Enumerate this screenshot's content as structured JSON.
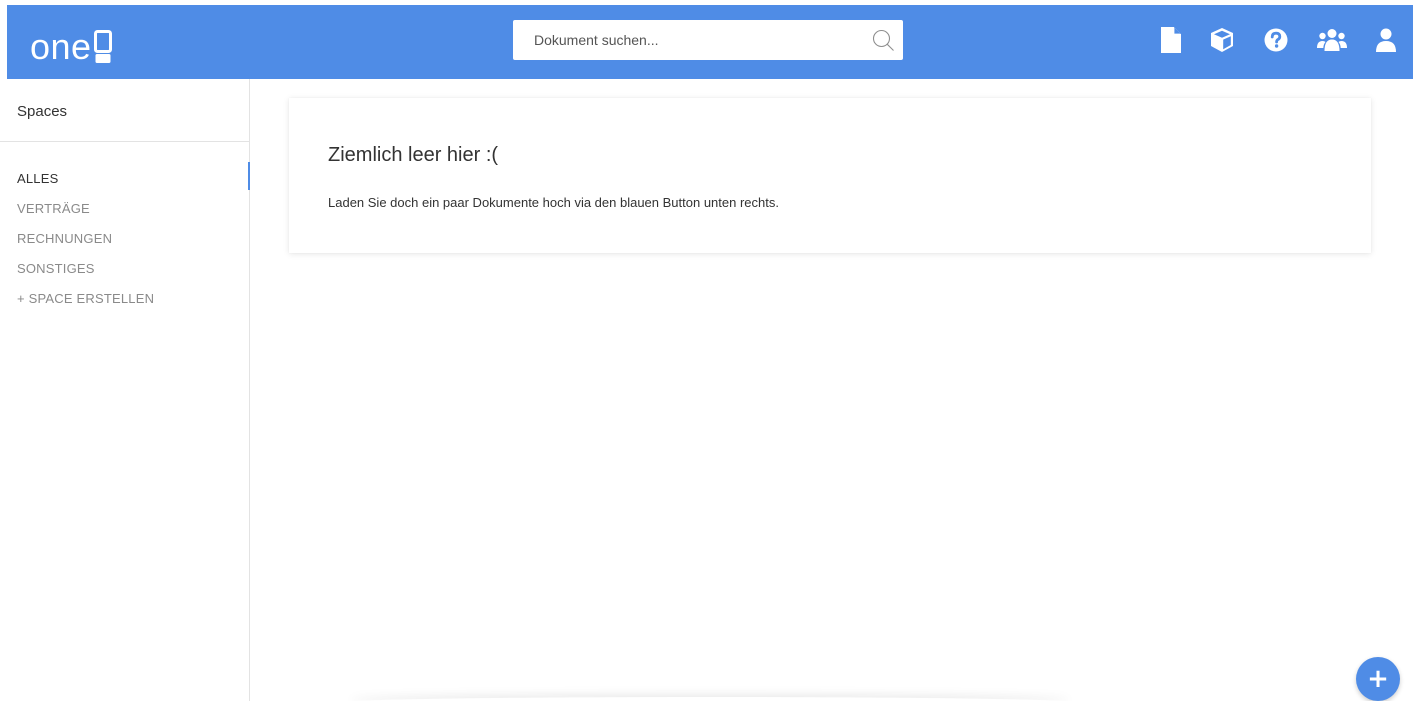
{
  "header": {
    "logo_text": "one",
    "search": {
      "placeholder": "Dokument suchen...",
      "value": ""
    },
    "icons": [
      "document-icon",
      "cube-icon",
      "help-icon",
      "users-icon",
      "user-icon"
    ]
  },
  "sidebar": {
    "title": "Spaces",
    "items": [
      {
        "label": "ALLES",
        "active": true
      },
      {
        "label": "VERTRÄGE",
        "active": false
      },
      {
        "label": "RECHNUNGEN",
        "active": false
      },
      {
        "label": "SONSTIGES",
        "active": false
      },
      {
        "label": "+ SPACE ERSTELLEN",
        "active": false
      }
    ]
  },
  "main": {
    "empty_title": "Ziemlich leer hier :(",
    "empty_text": "Laden Sie doch ein paar Dokumente hoch via den blauen Button unten rechts."
  },
  "fab": {
    "label": "+"
  },
  "colors": {
    "brand": "#4f8ce6",
    "text": "#333333",
    "muted": "#8a8a8a",
    "divider": "#e3e3e3"
  }
}
